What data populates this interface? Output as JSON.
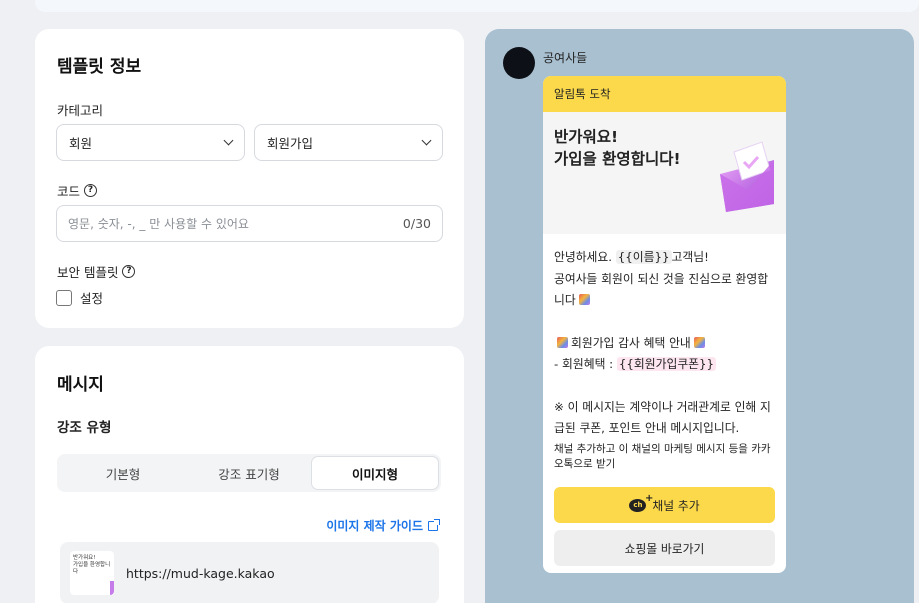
{
  "template_info": {
    "title": "템플릿 정보",
    "category_label": "카테고리",
    "category_main": "회원",
    "category_sub": "회원가입",
    "code_label": "코드",
    "code_placeholder": "영문, 숫자, -, _ 만 사용할 수 있어요",
    "code_counter": "0/30",
    "secure_label": "보안 템플릿",
    "secure_checkbox_label": "설정"
  },
  "message": {
    "title": "메시지",
    "emphasis_label": "강조 유형",
    "tabs": [
      "기본형",
      "강조 표기형",
      "이미지형"
    ],
    "active_tab": "이미지형",
    "guide_link": "이미지 제작 가이드",
    "image_url": "https://mud-kage.kakao",
    "thumb_text_1": "반가워요!",
    "thumb_text_2": "가입을 환영합니다"
  },
  "preview": {
    "sender": "공여사들",
    "header": "알림톡 도착",
    "image_title_1": "반가워요!",
    "image_title_2": "가입을 환영합니다!",
    "line1_a": "안녕하세요. ",
    "var_name": "{{이름}}",
    "line1_b": "고객님!",
    "line2": "공여사들 회원이 되신 것을 진심으로 환영합니다",
    "benefit_title": "회원가입 감사 혜택 안내",
    "benefit_prefix": "- 회원혜택 : ",
    "var_coupon": "{{회원가입쿠폰}}",
    "notice": "※ 이 메시지는 계약이나 거래관계로 인해 지급된 쿠폰, 포인트 안내 메시지입니다.",
    "marketing": "채널 추가하고 이 채널의 마케팅 메시지 등을 카카오톡으로 받기",
    "btn_add_channel": "채널 추가",
    "btn_shop": "쇼핑몰 바로가기",
    "channel_badge": "ch"
  }
}
